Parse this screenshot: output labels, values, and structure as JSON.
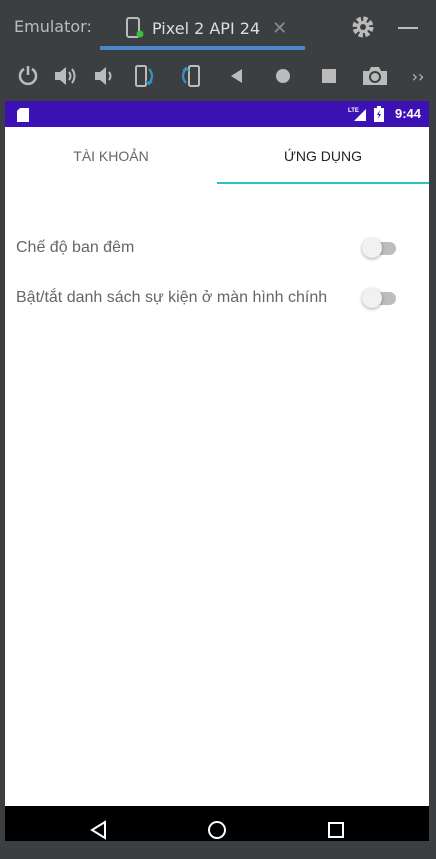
{
  "emulator": {
    "label": "Emulator:",
    "device_tab": "Pixel 2 API 24",
    "close_glyph": "✕",
    "icons": [
      "device-icon",
      "gear-icon",
      "minimize-icon"
    ],
    "toolbar_icons": [
      "power-icon",
      "volume-up-icon",
      "volume-down-icon",
      "rotate-left-icon",
      "rotate-right-icon",
      "back-icon",
      "home-icon",
      "overview-icon",
      "camera-icon",
      "more-icon"
    ],
    "more_glyph": "››"
  },
  "statusbar": {
    "time": "9:44",
    "network": "LTE",
    "color": "#3d12b4"
  },
  "tabs": [
    {
      "label": "TÀI KHOẢN",
      "selected": false
    },
    {
      "label": "ỨNG DỤNG",
      "selected": true
    }
  ],
  "accent_color": "#29c3c6",
  "settings": [
    {
      "label": "Chế độ ban đêm",
      "enabled": false
    },
    {
      "label": "Bật/tắt danh sách sự kiện ở màn hình chính",
      "enabled": false
    }
  ],
  "navbar": {
    "icons": [
      "back-triangle-icon",
      "home-circle-icon",
      "recents-square-icon"
    ]
  }
}
